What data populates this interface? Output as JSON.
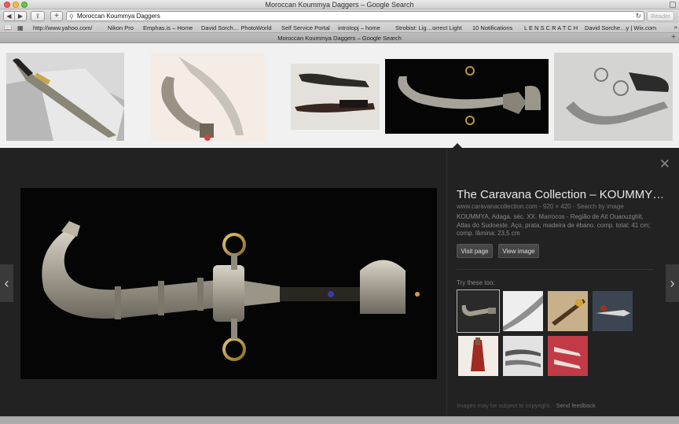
{
  "window": {
    "title": "Moroccan Koummya Daggers – Google Search"
  },
  "toolbar": {
    "url": "Moroccan Koummya Daggers",
    "reader_label": "Reader"
  },
  "bookmarks": [
    "http://www.yahoo.com/",
    "Nikon Pro",
    "Emphas.is – Home",
    "David Sorch… PhotoWorld",
    "Self Service Portal",
    "introtopj – home",
    "Strobist: Lig…orrect Light",
    "10 Notifications",
    "L E N S C R A T C H",
    "David Sorche…y | Wix.com"
  ],
  "tab": {
    "title": "Moroccan Koummya Daggers – Google Search"
  },
  "preview": {
    "title": "The Caravana Collection – KOUMMY…",
    "meta": "www.caravanacollection.com - 920 × 420 - Search by image",
    "description": "KOUMMYA, Adaga. séc. XX. Marrocos - Região de Ait Ouaouzghit, Atlas do Sudoeste. Aço, prata, madeira de ébano. comp. total: 41 cm; comp. lâmina: 23,5 cm",
    "visit_label": "Visit page",
    "view_label": "View image",
    "try_label": "Try these too:",
    "footer_copyright": "Images may be subject to copyright.",
    "footer_sep": "-",
    "footer_feedback": "Send feedback"
  },
  "colors": {
    "panel_bg": "#222222",
    "strip_bg": "#f1f1f1",
    "title_text": "#e8e8e8"
  },
  "icons": {
    "close": "close-icon",
    "prev": "chevron-left-icon",
    "next": "chevron-right-icon",
    "search": "search-icon",
    "reload": "reload-icon"
  }
}
